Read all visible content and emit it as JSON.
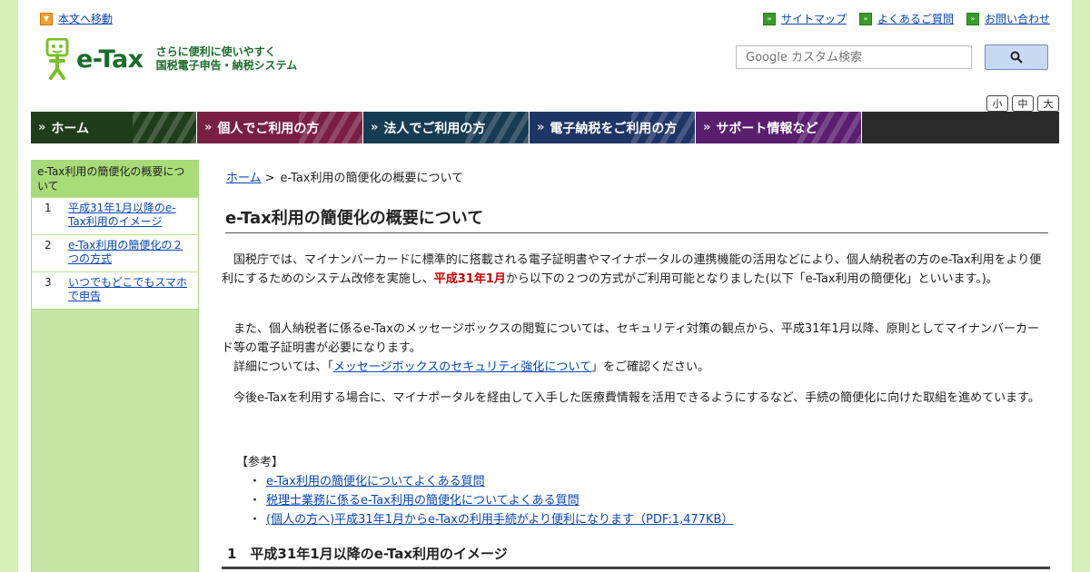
{
  "header": {
    "skip_link": "本文へ移動",
    "util_links": [
      "サイトマップ",
      "よくあるご質問",
      "お問い合わせ"
    ],
    "logo_text": "e-Tax",
    "tagline_line1": "さらに便利に使いやすく",
    "tagline_line2": "国税電子申告・納税システム",
    "search_placeholder": "Google カスタム検索",
    "font_sizes": [
      "小",
      "中",
      "大"
    ]
  },
  "nav": {
    "tabs": [
      "ホーム",
      "個人でご利用の方",
      "法人でご利用の方",
      "電子納税をご利用の方",
      "サポート情報など"
    ]
  },
  "sidebar": {
    "heading": "e-Tax利用の簡便化の概要について",
    "items": [
      {
        "num": "1",
        "label": "平成31年1月以降のe-Tax利用のイメージ"
      },
      {
        "num": "2",
        "label": "e-Tax利用の簡便化の２つの方式"
      },
      {
        "num": "3",
        "label": "いつでもどこでもスマホで申告"
      }
    ]
  },
  "main": {
    "breadcrumb_home": "ホーム",
    "breadcrumb_sep": ">",
    "breadcrumb_current": "e-Tax利用の簡便化の概要について",
    "title": "e-Tax利用の簡便化の概要について",
    "para1_a": "　国税庁では、マイナンバーカードに標準的に搭載される電子証明書やマイナポータルの連携機能の活用などにより、個人納税者の方のe-Tax利用をより便利にするためのシステム改修を実施し、",
    "para1_red": "平成31年1月",
    "para1_b": "から以下の２つの方式がご利用可能となりました(以下「e-Tax利用の簡便化」といいます。)。",
    "para2": "　また、個人納税者に係るe-Taxのメッセージボックスの閲覧については、セキュリティ対策の観点から、平成31年1月以降、原則としてマイナンバーカード等の電子証明書が必要になります。",
    "para3_a": "　詳細については、「",
    "para3_link": "メッセージボックスのセキュリティ強化について",
    "para3_b": "」をご確認ください。",
    "para4": "　今後e-Taxを利用する場合に、マイナポータルを経由して入手した医療費情報を活用できるようにするなど、手続の簡便化に向けた取組を進めています。",
    "refs_heading": "【参考】",
    "refs": [
      "e-Tax利用の簡便化についてよくある質問",
      "税理士業務に係るe-Tax利用の簡便化についてよくある質問",
      "(個人の方へ)平成31年1月からe-Taxの利用手続がより便利になります（PDF:1,477KB）"
    ],
    "section1_title": "1　平成31年1月以降のe-Tax利用のイメージ"
  }
}
